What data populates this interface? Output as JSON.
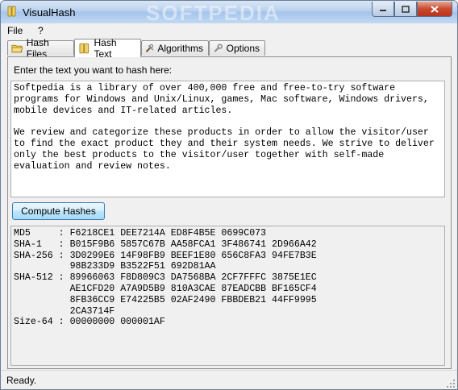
{
  "window": {
    "title": "VisualHash",
    "watermark": "SOFTPEDIA"
  },
  "menu": {
    "file": "File",
    "help": "?"
  },
  "tabs": [
    {
      "label": "Hash Files",
      "icon": "folder-icon"
    },
    {
      "label": "Hash Text",
      "icon": "text-icon"
    },
    {
      "label": "Algorithms",
      "icon": "tools-icon"
    },
    {
      "label": "Options",
      "icon": "wrench-icon"
    }
  ],
  "hash_text": {
    "prompt": "Enter the text you want to hash here:",
    "input_value": "Softpedia is a library of over 400,000 free and free-to-try software\nprograms for Windows and Unix/Linux, games, Mac software, Windows drivers,\nmobile devices and IT-related articles.\n\nWe review and categorize these products in order to allow the visitor/user\nto find the exact product they and their system needs. We strive to deliver\nonly the best products to the visitor/user together with self-made\nevaluation and review notes.",
    "compute_label": "Compute Hashes",
    "output": "MD5     : F6218CE1 DEE7214A ED8F4B5E 0699C073\nSHA-1   : B015F9B6 5857C67B AA58FCA1 3F486741 2D966A42\nSHA-256 : 3D0299E6 14F98FB9 BEEF1E80 656C8FA3 94FE7B3E\n          98B233D9 B3522F51 692D81AA\nSHA-512 : 89966063 F8D809C3 DA7568BA 2CF7FFFC 3875E1EC\n          AE1CFD20 A7A9D5B9 810A3CAE 87EADCBB BF165CF4\n          8FB36CC9 E74225B5 02AF2490 FBBDEB21 44FF9995\n          2CA3714F\nSize-64 : 00000000 000001AF"
  },
  "status": {
    "text": "Ready."
  }
}
